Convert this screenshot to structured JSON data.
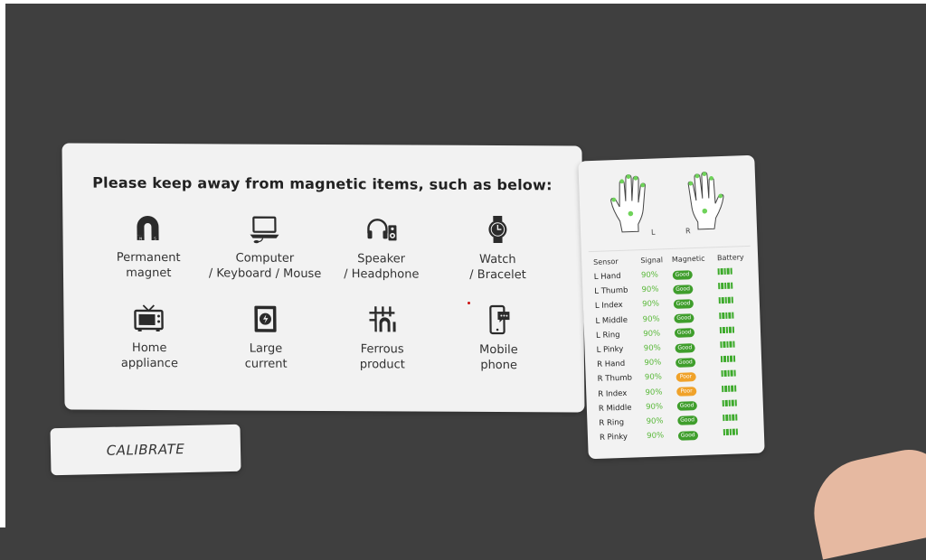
{
  "main_panel": {
    "title": "Please keep away from magnetic items, such as below:",
    "items": [
      {
        "label": "Permanent\nmagnet",
        "icon": "magnet-icon"
      },
      {
        "label": "Computer\n/ Keyboard / Mouse",
        "icon": "laptop-icon"
      },
      {
        "label": "Speaker\n/ Headphone",
        "icon": "headphone-speaker-icon"
      },
      {
        "label": "Watch\n/ Bracelet",
        "icon": "watch-icon"
      },
      {
        "label": "Home\nappliance",
        "icon": "tv-icon"
      },
      {
        "label": "Large\ncurrent",
        "icon": "battery-charge-icon"
      },
      {
        "label": "Ferrous\nproduct",
        "icon": "ferrous-grid-icon"
      },
      {
        "label": "Mobile\nphone",
        "icon": "mobile-phone-icon"
      }
    ]
  },
  "calibrate_button": "CALIBRATE",
  "sensor_panel": {
    "left_hand_label": "L",
    "right_hand_label": "R",
    "headers": [
      "Sensor",
      "Signal",
      "Magnetic",
      "Battery"
    ],
    "rows": [
      {
        "sensor": "L Hand",
        "signal": "90%",
        "magnetic": "Good",
        "battery_level": 1.0
      },
      {
        "sensor": "L Thumb",
        "signal": "90%",
        "magnetic": "Good",
        "battery_level": 1.0
      },
      {
        "sensor": "L Index",
        "signal": "90%",
        "magnetic": "Good",
        "battery_level": 1.0
      },
      {
        "sensor": "L Middle",
        "signal": "90%",
        "magnetic": "Good",
        "battery_level": 1.0
      },
      {
        "sensor": "L Ring",
        "signal": "90%",
        "magnetic": "Good",
        "battery_level": 1.0
      },
      {
        "sensor": "L Pinky",
        "signal": "90%",
        "magnetic": "Good",
        "battery_level": 1.0
      },
      {
        "sensor": "R Hand",
        "signal": "90%",
        "magnetic": "Good",
        "battery_level": 1.0
      },
      {
        "sensor": "R Thumb",
        "signal": "90%",
        "magnetic": "Poor",
        "battery_level": 1.0
      },
      {
        "sensor": "R Index",
        "signal": "90%",
        "magnetic": "Poor",
        "battery_level": 1.0
      },
      {
        "sensor": "R Middle",
        "signal": "90%",
        "magnetic": "Good",
        "battery_level": 1.0
      },
      {
        "sensor": "R Ring",
        "signal": "90%",
        "magnetic": "Good",
        "battery_level": 1.0
      },
      {
        "sensor": "R Pinky",
        "signal": "90%",
        "magnetic": "Good",
        "battery_level": 1.0
      }
    ]
  },
  "colors": {
    "good": "#3f9e2c",
    "poor": "#f0a22a",
    "signal": "#58b838",
    "sensor_dot": "#6fd35a",
    "background": "#3f3f3f",
    "panel": "#f2f2f2"
  }
}
